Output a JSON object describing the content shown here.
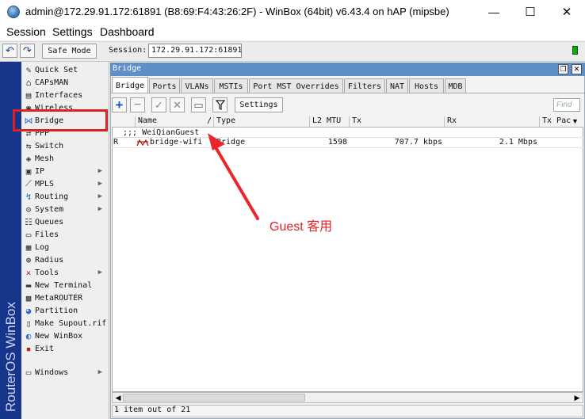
{
  "window": {
    "title": "admin@172.29.91.172:61891 (B8:69:F4:43:26:2F) - WinBox (64bit) v6.43.4 on hAP (mipsbe)",
    "minimize": "—",
    "maximize": "☐",
    "close": "✕"
  },
  "menu": [
    "Session",
    "Settings",
    "Dashboard"
  ],
  "toolbar": {
    "undo_icon": "undo-icon",
    "redo_icon": "redo-icon",
    "safe_mode": "Safe Mode",
    "session_label": "Session:",
    "session_value": "172.29.91.172:61891",
    "status_color": "#14a514"
  },
  "brand": {
    "text": "RouterOS WinBox",
    "bar_color": "#17358a"
  },
  "sidebar": {
    "items": [
      {
        "label": "Quick Set",
        "icon": "quickset-icon",
        "arrow": ""
      },
      {
        "label": "CAPsMAN",
        "icon": "capsman-icon",
        "arrow": ""
      },
      {
        "label": "Interfaces",
        "icon": "interfaces-icon",
        "arrow": ""
      },
      {
        "label": "Wireless",
        "icon": "wireless-icon",
        "arrow": ""
      },
      {
        "label": "Bridge",
        "icon": "bridge-icon",
        "arrow": ""
      },
      {
        "label": "PPP",
        "icon": "ppp-icon",
        "arrow": ""
      },
      {
        "label": "Switch",
        "icon": "switch-icon",
        "arrow": ""
      },
      {
        "label": "Mesh",
        "icon": "mesh-icon",
        "arrow": ""
      },
      {
        "label": "IP",
        "icon": "ip-icon",
        "arrow": "▶"
      },
      {
        "label": "MPLS",
        "icon": "mpls-icon",
        "arrow": "▶"
      },
      {
        "label": "Routing",
        "icon": "routing-icon",
        "arrow": "▶"
      },
      {
        "label": "System",
        "icon": "system-icon",
        "arrow": "▶"
      },
      {
        "label": "Queues",
        "icon": "queues-icon",
        "arrow": ""
      },
      {
        "label": "Files",
        "icon": "files-icon",
        "arrow": ""
      },
      {
        "label": "Log",
        "icon": "log-icon",
        "arrow": ""
      },
      {
        "label": "Radius",
        "icon": "radius-icon",
        "arrow": ""
      },
      {
        "label": "Tools",
        "icon": "tools-icon",
        "arrow": "▶"
      },
      {
        "label": "New Terminal",
        "icon": "terminal-icon",
        "arrow": ""
      },
      {
        "label": "MetaROUTER",
        "icon": "metarouter-icon",
        "arrow": ""
      },
      {
        "label": "Partition",
        "icon": "partition-icon",
        "arrow": ""
      },
      {
        "label": "Make Supout.rif",
        "icon": "supout-icon",
        "arrow": ""
      },
      {
        "label": "New WinBox",
        "icon": "winbox-icon",
        "arrow": ""
      },
      {
        "label": "Exit",
        "icon": "exit-icon",
        "arrow": ""
      },
      {
        "label": "Windows",
        "icon": "windows-icon",
        "arrow": "▶"
      }
    ]
  },
  "bridge_window": {
    "title": "Bridge",
    "restore": "❐",
    "close": "✕",
    "tabs": [
      "Bridge",
      "Ports",
      "VLANs",
      "MSTIs",
      "Port MST Overrides",
      "Filters",
      "NAT",
      "Hosts",
      "MDB"
    ],
    "actions": {
      "add": "+",
      "remove": "−",
      "enable": "✓",
      "disable": "✕",
      "comment": "▭",
      "filter": "filter-icon",
      "settings": "Settings"
    },
    "find_placeholder": "Find",
    "columns": [
      "Name",
      "/",
      "Type",
      "L2 MTU",
      "Tx",
      "Rx",
      "Tx Pac"
    ],
    "comment_row": ";;; WeiQianGuest",
    "rows": [
      {
        "flag": "R",
        "name": "bridge-wifi",
        "type": "Bridge",
        "l2mtu": "1598",
        "tx": "707.7 kbps",
        "rx": "2.1 Mbps",
        "txpac": ""
      }
    ],
    "scroll_left": "◀",
    "scroll_right": "▶",
    "status": "1 item out of 21"
  },
  "annotation": {
    "text": "Guest 客用",
    "color": "#e0202c"
  }
}
